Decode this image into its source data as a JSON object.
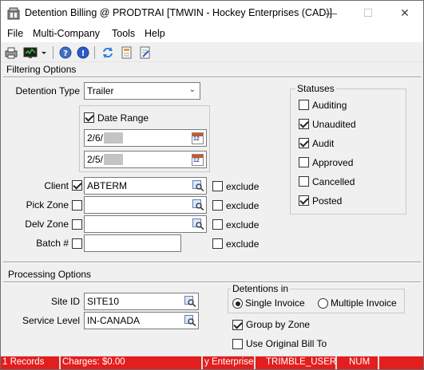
{
  "window": {
    "title": "Detention Billing @ PRODTRAI [TMWIN - Hockey Enterprises (CAD)]",
    "minimize_glyph": "—",
    "maximize_glyph": "☐",
    "close_glyph": "✕"
  },
  "menu": [
    "File",
    "Multi-Company",
    "Tools",
    "Help"
  ],
  "toolbar_icons": [
    "printer-icon",
    "monitor-icon",
    "dropdown-arrow-icon",
    "help-icon",
    "info-icon",
    "refresh-icon",
    "document-icon",
    "document-edit-icon"
  ],
  "filtering": {
    "group_title": "Filtering Options",
    "detention_type": {
      "label": "Detention Type",
      "value": "Trailer"
    },
    "date_range": {
      "label": "Date Range",
      "checked": true,
      "start": "2/6/",
      "end": "2/5/",
      "calendar_glyph": "12"
    },
    "client": {
      "label": "Client",
      "checked": true,
      "value": "ABTERM",
      "exclude_label": "exclude",
      "exclude_checked": false
    },
    "pick_zone": {
      "label": "Pick Zone",
      "checked": false,
      "value": "",
      "exclude_label": "exclude",
      "exclude_checked": false
    },
    "delv_zone": {
      "label": "Delv Zone",
      "checked": false,
      "value": "",
      "exclude_label": "exclude",
      "exclude_checked": false
    },
    "batch": {
      "label": "Batch #",
      "checked": false,
      "value": "",
      "exclude_label": "exclude",
      "exclude_checked": false
    }
  },
  "statuses": {
    "title": "Statuses",
    "items": [
      {
        "label": "Auditing",
        "checked": false
      },
      {
        "label": "Unaudited",
        "checked": true
      },
      {
        "label": "Audit",
        "checked": true
      },
      {
        "label": "Approved",
        "checked": false
      },
      {
        "label": "Cancelled",
        "checked": false
      },
      {
        "label": "Posted",
        "checked": true
      }
    ]
  },
  "processing": {
    "group_title": "Processing Options",
    "site_id": {
      "label": "Site ID",
      "value": "SITE10"
    },
    "service_level": {
      "label": "Service Level",
      "value": "IN-CANADA"
    },
    "detentions_in": {
      "title": "Detentions in",
      "single_invoice": "Single Invoice",
      "multiple_invoice": "Multiple Invoice",
      "selected": "single"
    },
    "group_by_zone": {
      "label": "Group by Zone",
      "checked": true
    },
    "use_original_bill_to": {
      "label": "Use Original Bill To",
      "checked": false
    }
  },
  "status_bar": {
    "records": "1 Records",
    "charges": "Charges: $0.00",
    "company": "y Enterprises",
    "user": "TRIMBLE_USER",
    "num": "NUM",
    "color": "#e31e1e"
  }
}
